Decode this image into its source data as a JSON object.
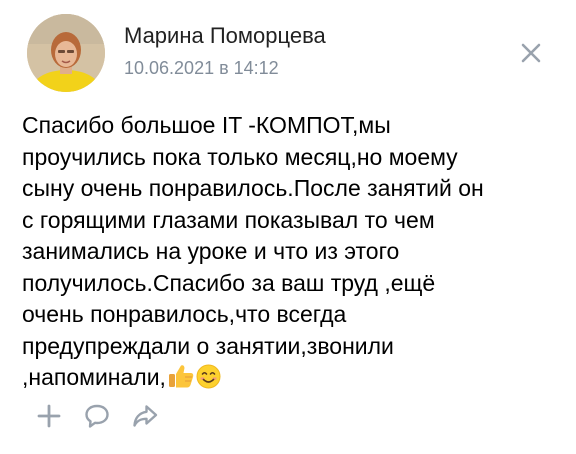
{
  "post": {
    "author": "Марина Поморцева",
    "date": "10.06.2021 в 14:12",
    "text_lines": [
      "Спасибо большое IT -КОМПОТ,мы",
      "проучились пока только месяц,но моему",
      "сыну очень понравилось.После занятий он",
      "с горящими глазами показывал то чем",
      "занимались на уроке и что из этого",
      "получилось.Спасибо за ваш труд ,ещё",
      "очень понравилось,что всегда",
      "предупреждали о занятии,звонили",
      ",напоминали,"
    ],
    "emojis": [
      "thumbs-up",
      "smiling-face"
    ]
  },
  "icons": {
    "close": "close-icon",
    "add": "plus-icon",
    "comment": "comment-icon",
    "share": "share-icon"
  },
  "colors": {
    "author": "#222222",
    "date": "#818c99",
    "icons": "#99a2ad",
    "text": "#000000"
  }
}
